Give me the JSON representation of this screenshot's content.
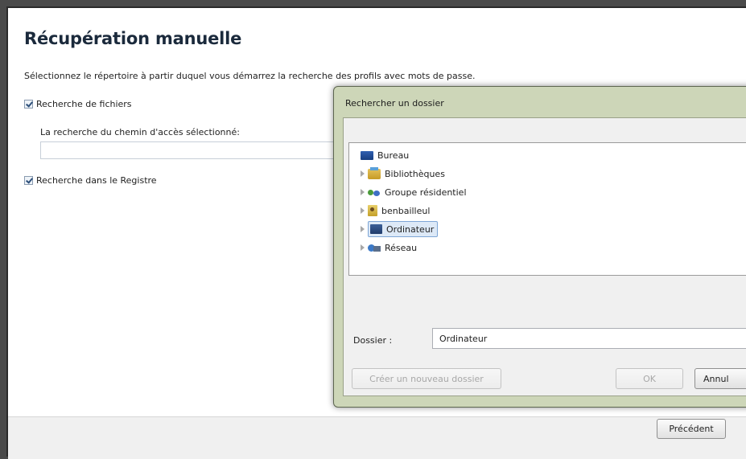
{
  "window": {
    "title": "Récupération manuelle",
    "instruction": "Sélectionnez le répertoire à partir duquel vous démarrez la recherche des profils avec mots de passe.",
    "file_search": {
      "label": "Recherche de fichiers",
      "checked": true
    },
    "path_label": "La recherche du chemin d'accès sélectionné:",
    "path_value": "",
    "registry_search": {
      "label": "Recherche dans le Registre",
      "checked": true
    },
    "footer": {
      "previous_label": "Précédent"
    }
  },
  "dialog": {
    "title": "Rechercher un dossier",
    "tree": [
      {
        "label": "Bureau",
        "icon": "desktop-icon",
        "expandable": false,
        "selected": false
      },
      {
        "label": "Bibliothèques",
        "icon": "libraries-icon",
        "expandable": true,
        "selected": false
      },
      {
        "label": "Groupe résidentiel",
        "icon": "homegroup-icon",
        "expandable": true,
        "selected": false
      },
      {
        "label": "benbailleul",
        "icon": "user-folder-icon",
        "expandable": true,
        "selected": false
      },
      {
        "label": "Ordinateur",
        "icon": "computer-icon",
        "expandable": true,
        "selected": true
      },
      {
        "label": "Réseau",
        "icon": "network-icon",
        "expandable": true,
        "selected": false
      }
    ],
    "folder_label": "Dossier :",
    "folder_value": "Ordinateur",
    "new_folder_label": "Créer un nouveau dossier",
    "ok_label": "OK",
    "cancel_label": "Annul"
  },
  "colors": {
    "title": "#1b2a3c",
    "dialog_frame": "#cdd6b8",
    "selection": "#dde9f7"
  }
}
